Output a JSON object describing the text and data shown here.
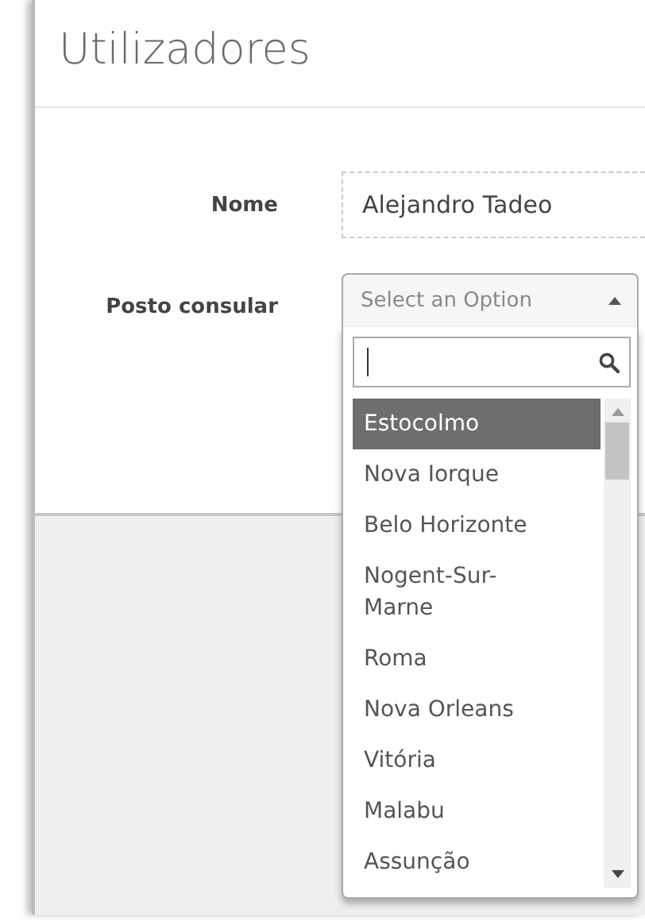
{
  "page": {
    "title": "Utilizadores"
  },
  "form": {
    "fields": [
      {
        "kind": "text",
        "label": "Nome",
        "value": "Alejandro Tadeo"
      },
      {
        "kind": "select",
        "label": "Posto consular",
        "placeholder": "Select an Option",
        "expanded": true,
        "options": [
          {
            "label": "Estocolmo",
            "selected": true
          },
          {
            "label": "Nova Iorque",
            "selected": false
          },
          {
            "label": "Belo Horizonte",
            "selected": false
          },
          {
            "label": "Nogent-Sur-Marne",
            "selected": false
          },
          {
            "label": "Roma",
            "selected": false
          },
          {
            "label": "Nova Orleans",
            "selected": false
          },
          {
            "label": "Vitória",
            "selected": false
          },
          {
            "label": "Malabu",
            "selected": false
          },
          {
            "label": "Assunção",
            "selected": false
          }
        ]
      }
    ]
  }
}
